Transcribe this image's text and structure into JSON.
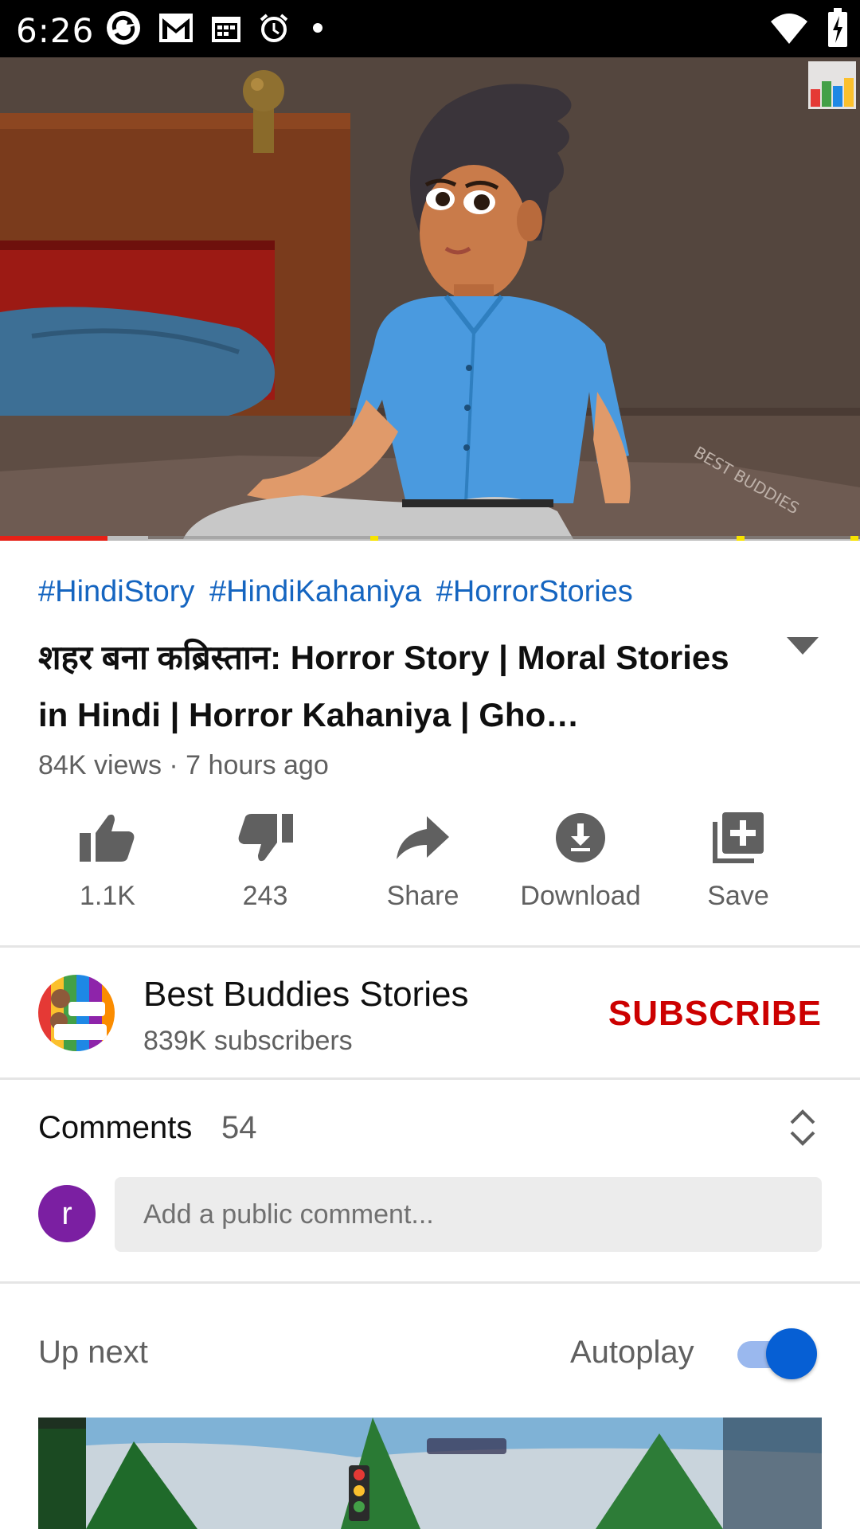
{
  "status_bar": {
    "time": "6:26",
    "icons_left": [
      "sync-icon",
      "gmail-icon",
      "calendar-icon",
      "alarm-icon",
      "dot-icon"
    ],
    "icons_right": [
      "wifi-icon",
      "battery-charging-icon"
    ]
  },
  "player": {
    "progress_fraction": 0.125,
    "buffered_fraction": 0.172,
    "colors": {
      "played": "#e62117",
      "ad_marker": "#f7e300"
    }
  },
  "video": {
    "hashtags": [
      "#HindiStory",
      "#HindiKahaniya",
      "#HorrorStories"
    ],
    "title": "शहर बना कब्रिस्तान: Horror Story | Moral Stories in Hindi | Horror Kahaniya | Gho…",
    "meta": "84K views · 7 hours ago"
  },
  "actions": {
    "like": "1.1K",
    "dislike": "243",
    "share": "Share",
    "download": "Download",
    "save": "Save"
  },
  "channel": {
    "name": "Best Buddies Stories",
    "subscribers": "839K subscribers",
    "subscribe_label": "SUBSCRIBE",
    "subscribe_color": "#cc0000"
  },
  "comments": {
    "label": "Comments",
    "count": "54",
    "user_initial": "r",
    "user_avatar_color": "#7b1fa2",
    "input_placeholder": "Add a public comment..."
  },
  "up_next": {
    "label": "Up next",
    "autoplay_label": "Autoplay",
    "autoplay_on": true
  }
}
